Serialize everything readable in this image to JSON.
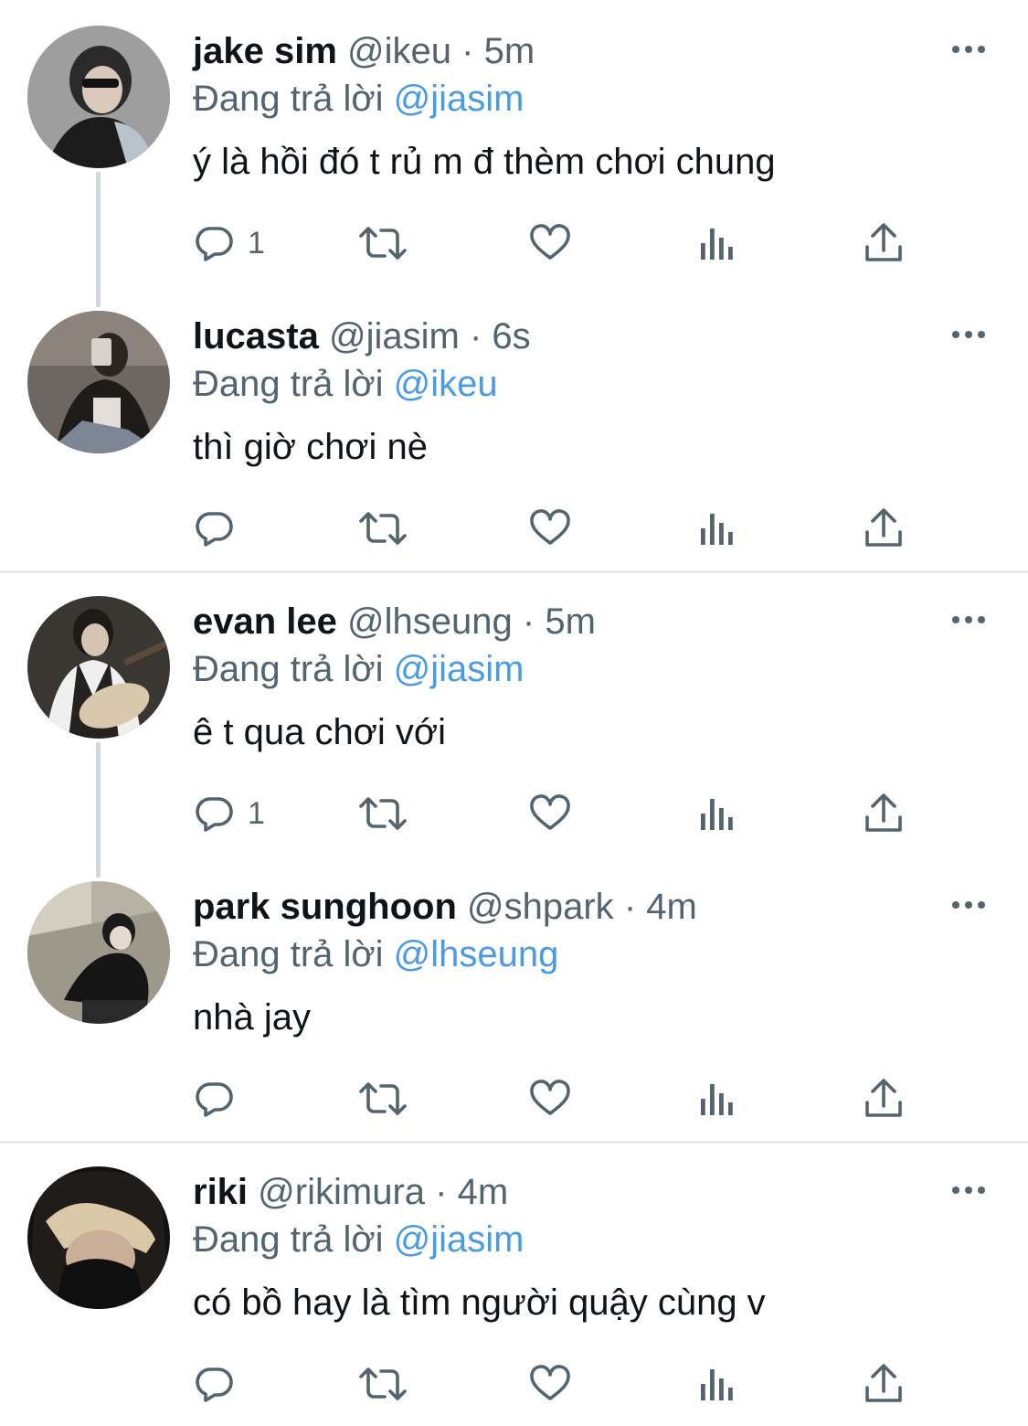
{
  "colors": {
    "text": "#0f1419",
    "secondary": "#536471",
    "mention": "#4a9be4",
    "icon": "#536471"
  },
  "tweets": [
    {
      "name": "jake sim",
      "handle": "@ikeu",
      "dot": "·",
      "time": "5m",
      "replying_label": "Đang trả lời",
      "replying_to": "@jiasim",
      "text": "ý là hồi đó t rủ m đ thèm chơi chung",
      "reply_count": "1"
    },
    {
      "name": "lucasta",
      "handle": "@jiasim",
      "dot": "·",
      "time": "6s",
      "replying_label": "Đang trả lời",
      "replying_to": "@ikeu",
      "text": "thì giờ chơi nè",
      "reply_count": ""
    },
    {
      "name": "evan lee",
      "handle": "@lhseung",
      "dot": "·",
      "time": "5m",
      "replying_label": "Đang trả lời",
      "replying_to": "@jiasim",
      "text": "ê t qua chơi với",
      "reply_count": "1"
    },
    {
      "name": "park sunghoon",
      "handle": "@shpark",
      "dot": "·",
      "time": "4m",
      "replying_label": "Đang trả lời",
      "replying_to": "@lhseung",
      "text": "nhà jay",
      "reply_count": ""
    },
    {
      "name": "riki",
      "handle": "@rikimura",
      "dot": "·",
      "time": "4m",
      "replying_label": "Đang trả lời",
      "replying_to": "@jiasim",
      "text": "có bồ hay là tìm người quậy cùng v",
      "reply_count": ""
    }
  ],
  "icons": {
    "reply": "reply-icon",
    "retweet": "retweet-icon",
    "like": "heart-icon",
    "views": "views-icon",
    "share": "share-icon",
    "more": "more-icon"
  }
}
